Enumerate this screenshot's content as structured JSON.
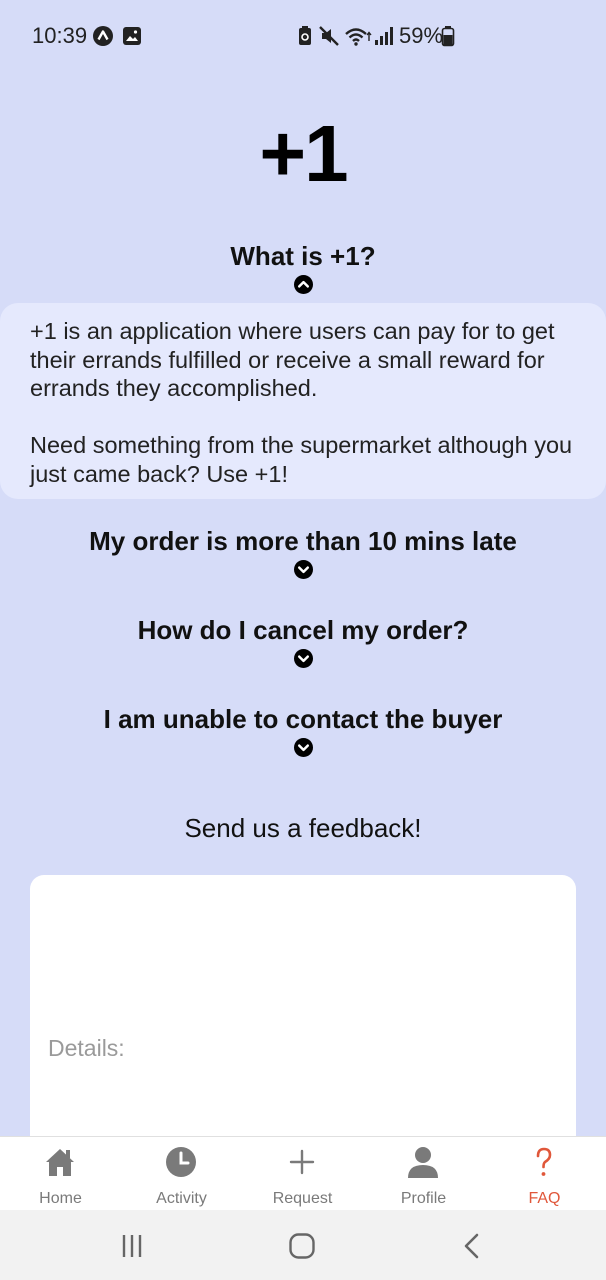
{
  "status_bar": {
    "time": "10:39",
    "battery": "59%"
  },
  "app_title": "+1",
  "faq": [
    {
      "question": "What is +1?",
      "expanded": true,
      "answer_paragraphs": [
        "+1 is an application where users can pay for to get their errands fulfilled or receive a small reward for errands they accomplished.",
        "Need something from the supermarket although you just came back? Use +1!"
      ]
    },
    {
      "question": "My order is more than 10 mins late",
      "expanded": false
    },
    {
      "question": "How do I cancel my order?",
      "expanded": false
    },
    {
      "question": "I am unable to contact the buyer",
      "expanded": false
    }
  ],
  "feedback": {
    "title": "Send us a feedback!",
    "details_placeholder": "Details:",
    "details_value": ""
  },
  "bottom_nav": {
    "items": [
      {
        "label": "Home",
        "icon": "home-icon"
      },
      {
        "label": "Activity",
        "icon": "clock-icon"
      },
      {
        "label": "Request",
        "icon": "plus-icon"
      },
      {
        "label": "Profile",
        "icon": "person-icon"
      },
      {
        "label": "FAQ",
        "icon": "question-icon",
        "active": true
      }
    ]
  },
  "colors": {
    "background": "#d6dcf8",
    "answer_card": "#e5e9fd",
    "active_tab": "#e0573a",
    "inactive_tab": "#7a7a7a"
  }
}
